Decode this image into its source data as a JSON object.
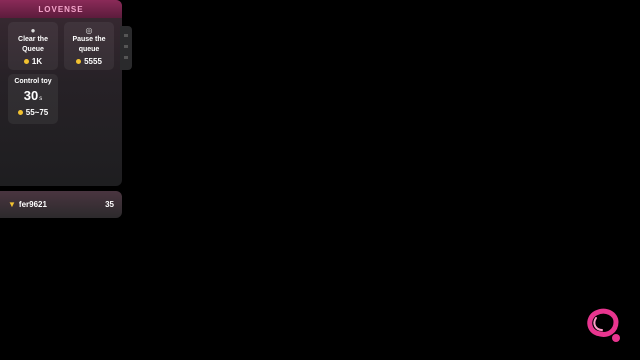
{
  "panel": {
    "title": "LOVENSE"
  },
  "cards": {
    "clear_queue": {
      "title_line1": "Clear the",
      "title_line2": "Queue",
      "price": "1K",
      "icon": "bell-icon"
    },
    "pause_queue": {
      "title_line1": "Pause the",
      "title_line2": "queue",
      "price": "5555",
      "icon": "pause-circle-icon"
    },
    "control_toy": {
      "title": "Control toy",
      "time": "30",
      "time_unit": "s",
      "price": "55~75"
    }
  },
  "leaderboard": {
    "user": "fer9621",
    "value": "35",
    "icon": "trophy-icon"
  },
  "colors": {
    "accent": "#e8358f",
    "coin": "#f2c230"
  }
}
